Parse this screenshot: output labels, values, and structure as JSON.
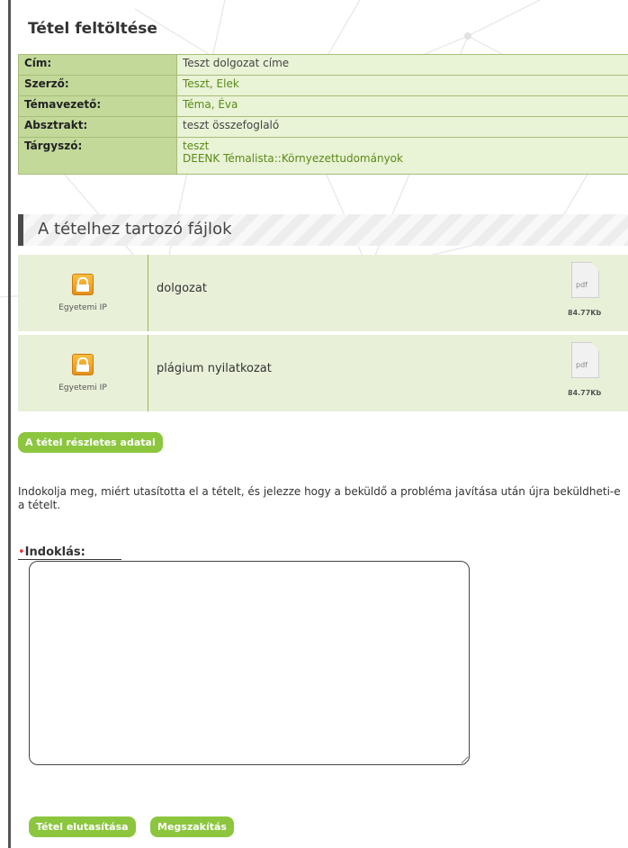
{
  "page": {
    "title": "Tétel feltöltése"
  },
  "metadata": {
    "rows": [
      {
        "label": "Cím:",
        "values": [
          "Teszt dolgozat címe"
        ]
      },
      {
        "label": "Szerző:",
        "values": [
          "Teszt, Elek"
        ]
      },
      {
        "label": "Témavezető:",
        "values": [
          "Téma, Éva"
        ]
      },
      {
        "label": "Absztrakt:",
        "values": [
          "teszt összefoglaló"
        ]
      },
      {
        "label": "Tárgyszó:",
        "values": [
          "teszt",
          "DEENK Témalista::Környezettudományok"
        ]
      }
    ]
  },
  "files_section": {
    "heading": "A tételhez tartozó fájlok",
    "files": [
      {
        "access_label": "Egyetemi IP",
        "access_icon": "unlock-icon",
        "name": "dolgozat",
        "file_type": "pdf",
        "size": "84.77Kb"
      },
      {
        "access_label": "Egyetemi IP",
        "access_icon": "unlock-icon",
        "name": "plágium nyilatkozat",
        "file_type": "pdf",
        "size": "84.77Kb"
      }
    ]
  },
  "details_button": {
    "label": "A tétel részletes adatai"
  },
  "instruction": "Indokolja meg, miért utasította el a tételt, és jelezze hogy a beküldő a probléma javítása után újra beküldheti-e a tételt.",
  "reason_field": {
    "required_mark": "•",
    "label": "Indoklás:",
    "value": ""
  },
  "actions": {
    "reject_label": "Tétel elutasítása",
    "cancel_label": "Megszakítás"
  },
  "colors": {
    "accent_green": "#8cc63f",
    "table_key_bg": "#c3d99a",
    "table_value_bg": "#e9f3d6",
    "file_row_bg": "#e8f0d8",
    "lock_orange": "#f0a020",
    "required_red": "#e33333"
  }
}
